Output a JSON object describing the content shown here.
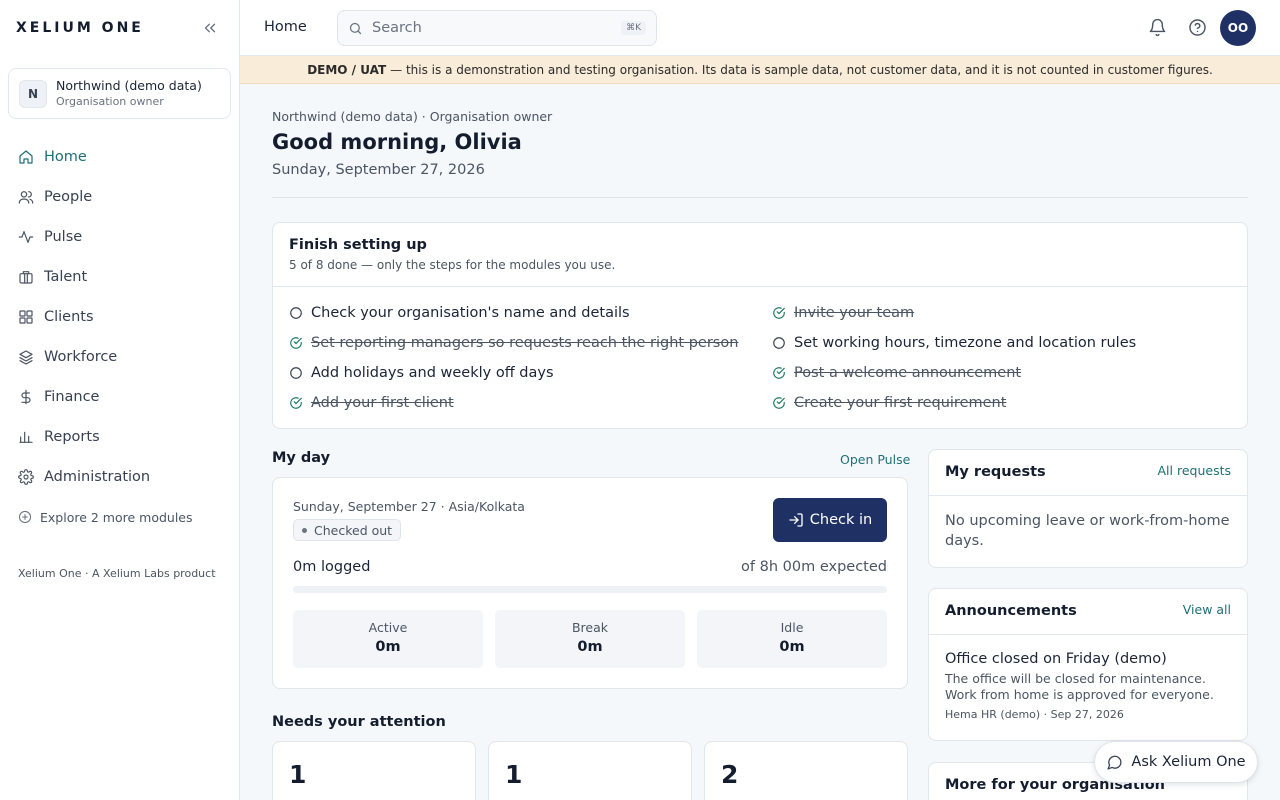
{
  "app": {
    "brand": "XELIUM ONE"
  },
  "org": {
    "badge": "N",
    "name": "Northwind (demo data)",
    "role": "Organisation owner"
  },
  "sidebar": {
    "items": [
      {
        "label": "Home",
        "icon": "home-icon",
        "active": true
      },
      {
        "label": "People",
        "icon": "people-icon"
      },
      {
        "label": "Pulse",
        "icon": "pulse-icon"
      },
      {
        "label": "Talent",
        "icon": "briefcase-icon"
      },
      {
        "label": "Clients",
        "icon": "grid-icon"
      },
      {
        "label": "Workforce",
        "icon": "layers-icon"
      },
      {
        "label": "Finance",
        "icon": "dollar-icon"
      },
      {
        "label": "Reports",
        "icon": "bar-chart-icon"
      },
      {
        "label": "Administration",
        "icon": "gear-icon"
      }
    ],
    "explore_label": "Explore 2 more modules",
    "footer": "Xelium One · A Xelium Labs product"
  },
  "topbar": {
    "title": "Home",
    "search_placeholder": "Search",
    "search_shortcut": "⌘K",
    "avatar_initials": "OO"
  },
  "banner": {
    "label": "DEMO / UAT",
    "text": "— this is a demonstration and testing organisation. Its data is sample data, not customer data, and it is not counted in customer figures."
  },
  "main": {
    "breadcrumb": "Northwind (demo data) · Organisation owner",
    "greeting": "Good morning, Olivia",
    "date": "Sunday, September 27, 2026"
  },
  "setup": {
    "title": "Finish setting up",
    "subtitle": "5 of 8 done — only the steps for the modules you use.",
    "steps": [
      {
        "label": "Check your organisation's name and details",
        "done": false
      },
      {
        "label": "Invite your team",
        "done": true
      },
      {
        "label": "Set reporting managers so requests reach the right person",
        "done": true
      },
      {
        "label": "Set working hours, timezone and location rules",
        "done": false
      },
      {
        "label": "Add holidays and weekly off days",
        "done": false
      },
      {
        "label": "Post a welcome announcement",
        "done": true
      },
      {
        "label": "Add your first client",
        "done": true
      },
      {
        "label": "Create your first requirement",
        "done": true
      }
    ]
  },
  "myday": {
    "title": "My day",
    "link": "Open Pulse",
    "date_tz": "Sunday, September 27 · Asia/Kolkata",
    "status": "Checked out",
    "checkin_label": "Check in",
    "logged": "0m logged",
    "expected": "of 8h 00m expected",
    "progress": 0,
    "stats": [
      {
        "label": "Active",
        "value": "0m"
      },
      {
        "label": "Break",
        "value": "0m"
      },
      {
        "label": "Idle",
        "value": "0m"
      }
    ]
  },
  "requests": {
    "title": "My requests",
    "link": "All requests",
    "empty": "No upcoming leave or work-from-home days."
  },
  "announcements": {
    "title": "Announcements",
    "link": "View all",
    "item_title": "Office closed on Friday (demo)",
    "item_body": "The office will be closed for maintenance. Work from home is approved for everyone.",
    "item_meta": "Hema HR (demo) · Sep 27, 2026"
  },
  "more": {
    "title": "More for your organisation"
  },
  "attention": {
    "title": "Needs your attention",
    "counts": [
      "1",
      "1",
      "2"
    ]
  },
  "assistant": {
    "label": "Ask Xelium One"
  },
  "colors": {
    "primary": "#1f3164",
    "accent": "#1f6f74",
    "done": "#1f7a5b",
    "banner": "#f9ecd8"
  }
}
